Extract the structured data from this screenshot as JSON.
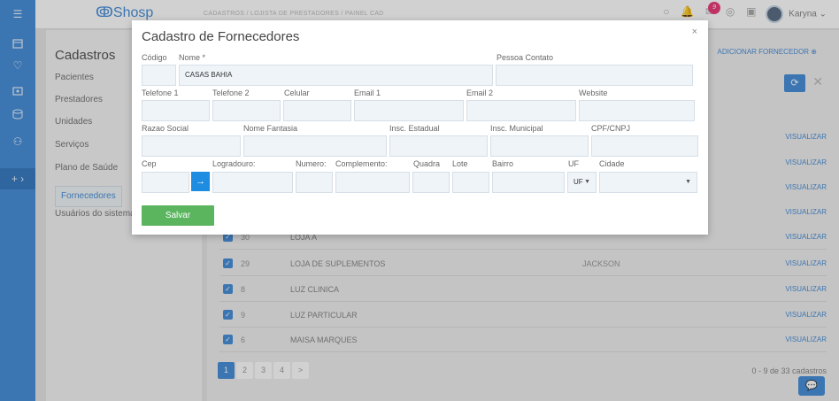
{
  "app": {
    "logo": "Shosp"
  },
  "topbar": {
    "crumbs": "CADASTROS    /    LOJISTA DE PRESTADORES    /    PAINEL CAD",
    "badge_count": "9",
    "user_name": "Karyna ⌄"
  },
  "sidebar": {
    "title": "Cadastros",
    "items": [
      {
        "label": "Pacientes"
      },
      {
        "label": "Prestadores"
      },
      {
        "label": "Unidades"
      },
      {
        "label": "Serviços"
      },
      {
        "label": "Plano de Saúde"
      },
      {
        "label": "Fornecedores"
      },
      {
        "label": "Usuários do sistema"
      }
    ]
  },
  "main": {
    "add_label": "ADICIONAR FORNECEDOR",
    "visualizar": "VISUALIZAR",
    "rows": [
      {
        "id": "30",
        "name": "LOJA A",
        "contact": ""
      },
      {
        "id": "29",
        "name": "LOJA DE SUPLEMENTOS",
        "contact": "JACKSON"
      },
      {
        "id": "8",
        "name": "LUZ CLINICA",
        "contact": ""
      },
      {
        "id": "9",
        "name": "LUZ PARTICULAR",
        "contact": ""
      },
      {
        "id": "6",
        "name": "MAISA MARQUES",
        "contact": ""
      }
    ],
    "pages": [
      "1",
      "2",
      "3",
      "4",
      ">"
    ],
    "count_text": "0 - 9 de 33 cadastros"
  },
  "modal": {
    "title": "Cadastro de Fornecedores",
    "close": "×",
    "labels": {
      "codigo": "Código",
      "nome": "Nome *",
      "pessoa_contato": "Pessoa Contato",
      "telefone1": "Telefone 1",
      "telefone2": "Telefone 2",
      "celular": "Celular",
      "email1": "Email 1",
      "email2": "Email 2",
      "website": "Website",
      "razao_social": "Razao Social",
      "nome_fantasia": "Nome Fantasia",
      "insc_estadual": "Insc. Estadual",
      "insc_municipal": "Insc. Municipal",
      "cpf_cnpj": "CPF/CNPJ",
      "cep": "Cep",
      "logradouro": "Logradouro:",
      "numero": "Numero:",
      "complemento": "Complemento:",
      "quadra": "Quadra",
      "lote": "Lote",
      "bairro": "Bairro",
      "uf": "UF",
      "cidade": "Cidade"
    },
    "values": {
      "nome": "CASAS BAHIA",
      "uf": "UF"
    },
    "save_label": "Salvar"
  },
  "colors": {
    "accent": "#4a90d9",
    "save": "#5ab55e",
    "badge": "#e93f7a"
  }
}
